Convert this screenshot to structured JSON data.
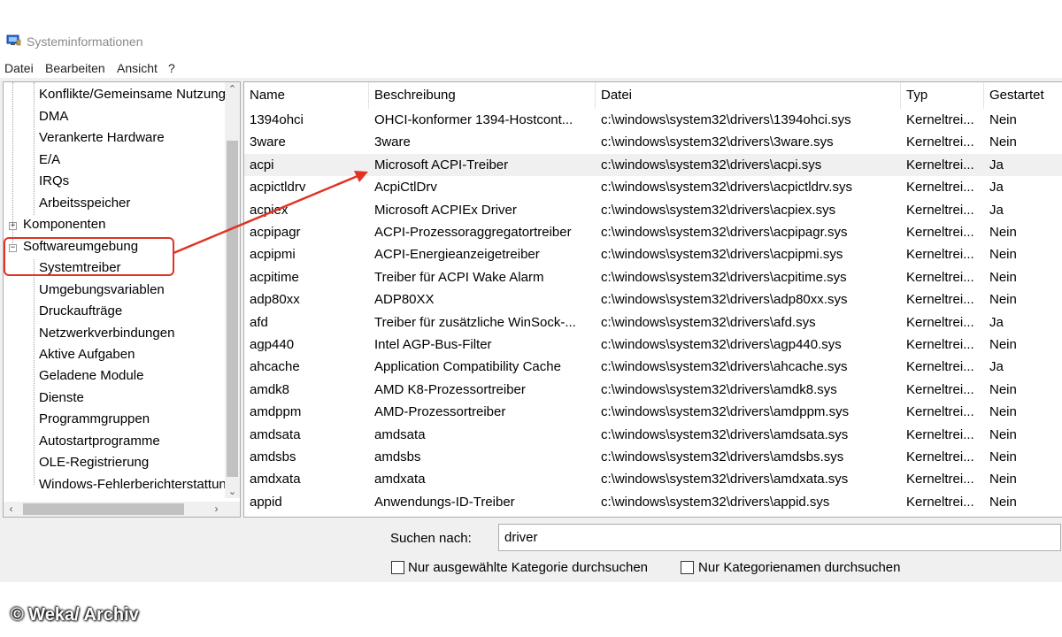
{
  "window": {
    "title": "Systeminformationen",
    "app_icon": "system-info-icon"
  },
  "menu": [
    "Datei",
    "Bearbeiten",
    "Ansicht",
    "?"
  ],
  "tree": {
    "items": [
      {
        "label": "Konflikte/Gemeinsame Nutzung",
        "level": 2
      },
      {
        "label": "DMA",
        "level": 2
      },
      {
        "label": "Verankerte Hardware",
        "level": 2
      },
      {
        "label": "E/A",
        "level": 2
      },
      {
        "label": "IRQs",
        "level": 2
      },
      {
        "label": "Arbeitsspeicher",
        "level": 2
      },
      {
        "label": "Komponenten",
        "level": 1,
        "expander": "+"
      },
      {
        "label": "Softwareumgebung",
        "level": 1,
        "expander": "−"
      },
      {
        "label": "Systemtreiber",
        "level": 2
      },
      {
        "label": "Umgebungsvariablen",
        "level": 2
      },
      {
        "label": "Druckaufträge",
        "level": 2
      },
      {
        "label": "Netzwerkverbindungen",
        "level": 2
      },
      {
        "label": "Aktive Aufgaben",
        "level": 2
      },
      {
        "label": "Geladene Module",
        "level": 2
      },
      {
        "label": "Dienste",
        "level": 2
      },
      {
        "label": "Programmgruppen",
        "level": 2
      },
      {
        "label": "Autostartprogramme",
        "level": 2
      },
      {
        "label": "OLE-Registrierung",
        "level": 2
      },
      {
        "label": "Windows-Fehlerberichterstattung",
        "level": 2
      }
    ],
    "scroll_up_icon": "chevron-up-icon",
    "scroll_down_icon": "chevron-down-icon",
    "scroll_left_icon": "chevron-left-icon",
    "scroll_right_icon": "chevron-right-icon"
  },
  "table": {
    "columns": [
      "Name",
      "Beschreibung",
      "Datei",
      "Typ",
      "Gestartet"
    ],
    "rows": [
      [
        "1394ohci",
        "OHCI-konformer 1394-Hostcont...",
        "c:\\windows\\system32\\drivers\\1394ohci.sys",
        "Kerneltrei...",
        "Nein"
      ],
      [
        "3ware",
        "3ware",
        "c:\\windows\\system32\\drivers\\3ware.sys",
        "Kerneltrei...",
        "Nein"
      ],
      [
        "acpi",
        "Microsoft ACPI-Treiber",
        "c:\\windows\\system32\\drivers\\acpi.sys",
        "Kerneltrei...",
        "Ja"
      ],
      [
        "acpictldrv",
        "AcpiCtlDrv",
        "c:\\windows\\system32\\drivers\\acpictldrv.sys",
        "Kerneltrei...",
        "Ja"
      ],
      [
        "acpiex",
        "Microsoft ACPIEx Driver",
        "c:\\windows\\system32\\drivers\\acpiex.sys",
        "Kerneltrei...",
        "Ja"
      ],
      [
        "acpipagr",
        "ACPI-Prozessoraggregatortreiber",
        "c:\\windows\\system32\\drivers\\acpipagr.sys",
        "Kerneltrei...",
        "Nein"
      ],
      [
        "acpipmi",
        "ACPI-Energieanzeigetreiber",
        "c:\\windows\\system32\\drivers\\acpipmi.sys",
        "Kerneltrei...",
        "Nein"
      ],
      [
        "acpitime",
        "Treiber für ACPI Wake Alarm",
        "c:\\windows\\system32\\drivers\\acpitime.sys",
        "Kerneltrei...",
        "Nein"
      ],
      [
        "adp80xx",
        "ADP80XX",
        "c:\\windows\\system32\\drivers\\adp80xx.sys",
        "Kerneltrei...",
        "Nein"
      ],
      [
        "afd",
        "Treiber für zusätzliche WinSock-...",
        "c:\\windows\\system32\\drivers\\afd.sys",
        "Kerneltrei...",
        "Ja"
      ],
      [
        "agp440",
        "Intel AGP-Bus-Filter",
        "c:\\windows\\system32\\drivers\\agp440.sys",
        "Kerneltrei...",
        "Nein"
      ],
      [
        "ahcache",
        "Application Compatibility Cache",
        "c:\\windows\\system32\\drivers\\ahcache.sys",
        "Kerneltrei...",
        "Ja"
      ],
      [
        "amdk8",
        "AMD K8-Prozessortreiber",
        "c:\\windows\\system32\\drivers\\amdk8.sys",
        "Kerneltrei...",
        "Nein"
      ],
      [
        "amdppm",
        "AMD-Prozessortreiber",
        "c:\\windows\\system32\\drivers\\amdppm.sys",
        "Kerneltrei...",
        "Nein"
      ],
      [
        "amdsata",
        "amdsata",
        "c:\\windows\\system32\\drivers\\amdsata.sys",
        "Kerneltrei...",
        "Nein"
      ],
      [
        "amdsbs",
        "amdsbs",
        "c:\\windows\\system32\\drivers\\amdsbs.sys",
        "Kerneltrei...",
        "Nein"
      ],
      [
        "amdxata",
        "amdxata",
        "c:\\windows\\system32\\drivers\\amdxata.sys",
        "Kerneltrei...",
        "Nein"
      ],
      [
        "appid",
        "Anwendungs-ID-Treiber",
        "c:\\windows\\system32\\drivers\\appid.sys",
        "Kerneltrei...",
        "Nein"
      ]
    ]
  },
  "search": {
    "label": "Suchen nach:",
    "value": "driver",
    "option_selected_category": "Nur ausgewählte Kategorie durchsuchen",
    "option_category_names": "Nur Kategorienamen durchsuchen"
  },
  "annotation": {
    "highlight_color": "#e03324"
  },
  "watermark": "© Weka/ Archiv"
}
